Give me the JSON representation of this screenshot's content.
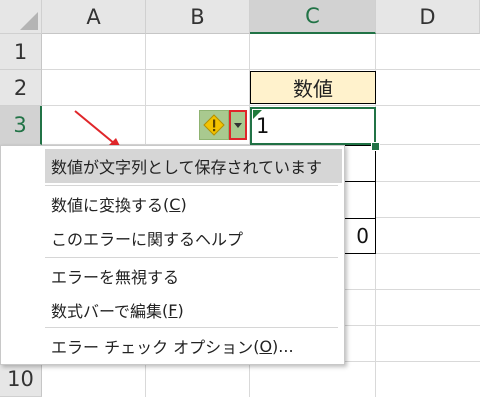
{
  "columns": [
    {
      "id": "A",
      "label": "A",
      "selected": false
    },
    {
      "id": "B",
      "label": "B",
      "selected": false
    },
    {
      "id": "C",
      "label": "C",
      "selected": true
    },
    {
      "id": "D",
      "label": "D",
      "selected": false
    }
  ],
  "rows": [
    {
      "label": "1"
    },
    {
      "label": "2"
    },
    {
      "label": "3"
    },
    {
      "label": "10"
    }
  ],
  "cells": {
    "c2_header": "数値",
    "c3_value": "1",
    "c6_value": "0"
  },
  "error_indicator": {
    "warning_icon": "exclamation-diamond-icon",
    "dropdown_icon": "dropdown-arrow-icon"
  },
  "context_menu": {
    "items": [
      {
        "label": "数値が文字列として保存されています",
        "shortcut": "",
        "highlighted": true
      },
      {
        "label": "数値に変換する",
        "shortcut": "C",
        "highlighted": false
      },
      {
        "label": "このエラーに関するヘルプ",
        "shortcut": "",
        "highlighted": false
      },
      {
        "label": "エラーを無視する",
        "shortcut": "",
        "highlighted": false
      },
      {
        "label": "数式バーで編集",
        "shortcut": "F",
        "highlighted": false
      },
      {
        "label": "エラー チェック オプション",
        "shortcut": "O",
        "suffix": "...",
        "highlighted": false
      }
    ]
  },
  "colors": {
    "header_fill": "#fff2cc",
    "selection_green": "#217346",
    "error_button_green": "#a9c98f",
    "warning_yellow": "#f2c200",
    "highlight_red": "#e0262a"
  }
}
